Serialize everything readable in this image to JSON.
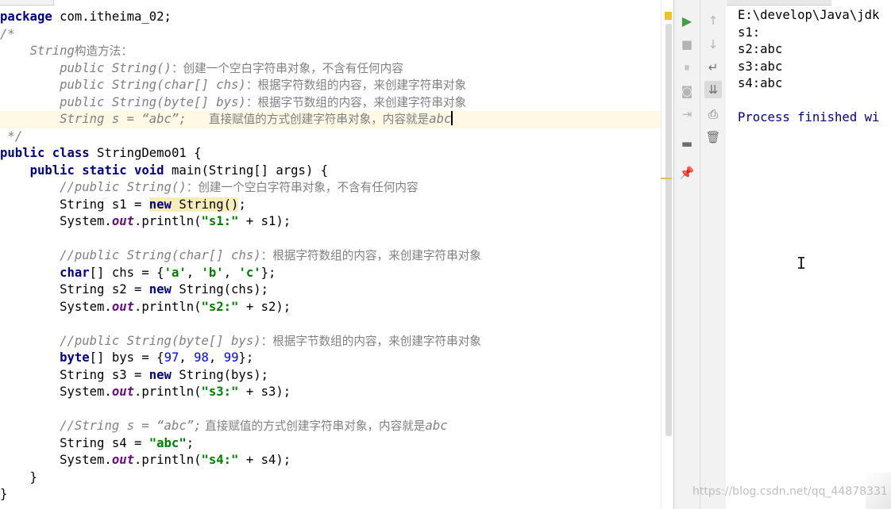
{
  "editor": {
    "lines": {
      "l01_kw": "package",
      "l01_rest": " com.itheima_02;",
      "l02_cm": "/*",
      "l03_ind": "    ",
      "l03_a": "String",
      "l03_b": "构造方法：",
      "l04_ind": "        ",
      "l04_a": "public String()",
      "l04_b": "：创建一个空白字符串对象，不含有任何内容",
      "l05_ind": "        ",
      "l05_a": "public String(char[] chs)",
      "l05_b": "：根据字符数组的内容，来创建字符串对象",
      "l06_ind": "        ",
      "l06_a": "public String(byte[] bys)",
      "l06_b": "：根据字节数组的内容，来创建字符串对象",
      "l07_ind": "        ",
      "l07_a": "String s = “abc”;",
      "l07_sp": "   ",
      "l07_b": "直接赋值的方式创建字符串对象，内容就是",
      "l07_c": "abc",
      "l08_cm": " */",
      "l09_kw": "public class",
      "l09_rest": " StringDemo01 {",
      "l10_ind": "    ",
      "l10_kw": "public static void",
      "l10_rest": " main(String[] args) {",
      "l11_ind": "        ",
      "l11_a": "//public String()",
      "l11_b": "：创建一个空白字符串对象，不含有任何内容",
      "l12_a": "        String s1 = ",
      "l12_kw": "new",
      "l12_hl": " String()",
      "l12_end": ";",
      "l13_a": "        System.",
      "l13_fld": "out",
      "l13_b": ".println(",
      "l13_st": "\"s1:\"",
      "l13_c": " + s1);",
      "l15_ind": "        ",
      "l15_a": "//public String(char[] chs)",
      "l15_b": "：根据字符数组的内容，来创建字符串对象",
      "l16_ind": "        ",
      "l16_kw": "char",
      "l16_a": "[] chs = {",
      "l16_s1": "'a'",
      "l16_c1": ", ",
      "l16_s2": "'b'",
      "l16_c2": ", ",
      "l16_s3": "'c'",
      "l16_end": "};",
      "l17_a": "        String s2 = ",
      "l17_kw": "new",
      "l17_b": " String(chs);",
      "l18_a": "        System.",
      "l18_fld": "out",
      "l18_b": ".println(",
      "l18_st": "\"s2:\"",
      "l18_c": " + s2);",
      "l20_ind": "        ",
      "l20_a": "//public String(byte[] bys)",
      "l20_b": "：根据字节数组的内容，来创建字符串对象",
      "l21_ind": "        ",
      "l21_kw": "byte",
      "l21_a": "[] bys = {",
      "l21_n1": "97",
      "l21_c1": ", ",
      "l21_n2": "98",
      "l21_c2": ", ",
      "l21_n3": "99",
      "l21_end": "};",
      "l22_a": "        String s3 = ",
      "l22_kw": "new",
      "l22_b": " String(bys);",
      "l23_a": "        System.",
      "l23_fld": "out",
      "l23_b": ".println(",
      "l23_st": "\"s3:\"",
      "l23_c": " + s3);",
      "l25_ind": "        ",
      "l25_a": "//String s = “abc”;",
      "l25_b": " 直接赋值的方式创建字符串对象，内容就是",
      "l25_c": "abc",
      "l26_a": "        String s4 = ",
      "l26_st": "\"abc\"",
      "l26_end": ";",
      "l27_a": "        System.",
      "l27_fld": "out",
      "l27_b": ".println(",
      "l27_st": "\"s4:\"",
      "l27_c": " + s4);",
      "l28": "    }",
      "l29": "}"
    }
  },
  "run_toolbar": {
    "icons": [
      "run-icon",
      "stop-icon",
      "pause-icon",
      "camera-icon",
      "exit-icon",
      "layout-icon",
      "pin-icon",
      "up-arrow-icon",
      "down-arrow-icon",
      "soft-wrap-icon",
      "scroll-to-end-icon",
      "print-icon",
      "trash-icon"
    ],
    "glyphs": {
      "run": "▶",
      "stop": "■",
      "pause": "⏸",
      "camera": "◙",
      "exit": "⇥",
      "layout": "▬",
      "pin": "📌",
      "up": "↑",
      "down": "↓",
      "wrap": "↵",
      "scroll_end": "⇊",
      "print": "⎙",
      "trash": "🗑"
    }
  },
  "console": {
    "lines": [
      "E:\\develop\\Java\\jdk",
      "s1:",
      "s2:abc",
      "s3:abc",
      "s4:abc",
      "",
      "Process finished wi"
    ]
  },
  "watermark": "https://blog.csdn.net/qq_44878331"
}
